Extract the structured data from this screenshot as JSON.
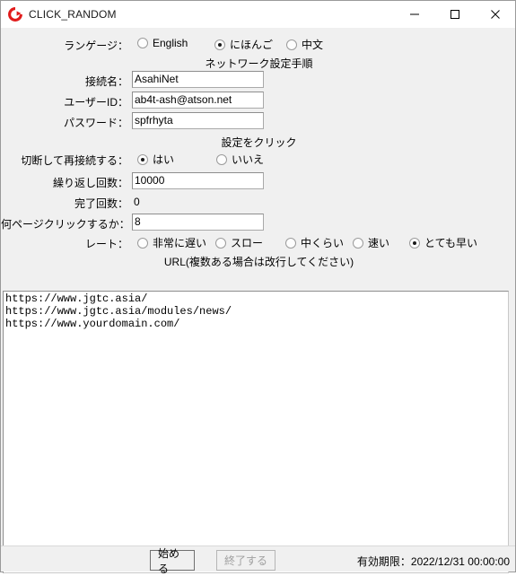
{
  "window": {
    "title": "CLICK_RANDOM",
    "icon": "refresh-circle-icon",
    "minimize_label": "−",
    "maximize_label": "□",
    "close_label": "✕",
    "accent_color": "#e11b1b",
    "background_color": "#f0f0f0"
  },
  "language_row": {
    "label": "ランゲージ：",
    "options": [
      {
        "label": "English",
        "selected": false
      },
      {
        "label": "にほんご",
        "selected": true
      },
      {
        "label": "中文",
        "selected": false
      }
    ]
  },
  "network_section": {
    "title": "ネットワーク設定手順",
    "fields": [
      {
        "label": "接続名：",
        "value": "AsahiNet"
      },
      {
        "label": "ユーザーID：",
        "value": "ab4t-ash@atson.net"
      },
      {
        "label": "パスワード：",
        "value": "spfrhyta"
      }
    ]
  },
  "settings_section": {
    "title": "設定をクリック",
    "reconnect": {
      "label": "切断して再接続する：",
      "options": [
        {
          "label": "はい",
          "selected": true
        },
        {
          "label": "いいえ",
          "selected": false
        }
      ]
    },
    "repeat_count": {
      "label": "繰り返し回数：",
      "value": "10000"
    },
    "completed_count": {
      "label": "完了回数：",
      "value": "0"
    },
    "pages_to_click": {
      "label": "何ページクリックするか：",
      "value": "8"
    },
    "rate": {
      "label": "レート：",
      "options": [
        {
          "label": "非常に遅い",
          "selected": false
        },
        {
          "label": "スロー",
          "selected": false
        },
        {
          "label": "中くらい",
          "selected": false
        },
        {
          "label": "速い",
          "selected": false
        },
        {
          "label": "とても早い",
          "selected": true
        }
      ]
    }
  },
  "url_section": {
    "title": "URL(複数ある場合は改行してください)",
    "value": "https://www.jgtc.asia/\nhttps://www.jgtc.asia/modules/news/\nhttps://www.yourdomain.com/"
  },
  "footer": {
    "start_button": "始める",
    "stop_button": "終了する",
    "stop_disabled": true,
    "expiry_label": "有効期限：",
    "expiry_value": "2022/12/31 00:00:00"
  }
}
